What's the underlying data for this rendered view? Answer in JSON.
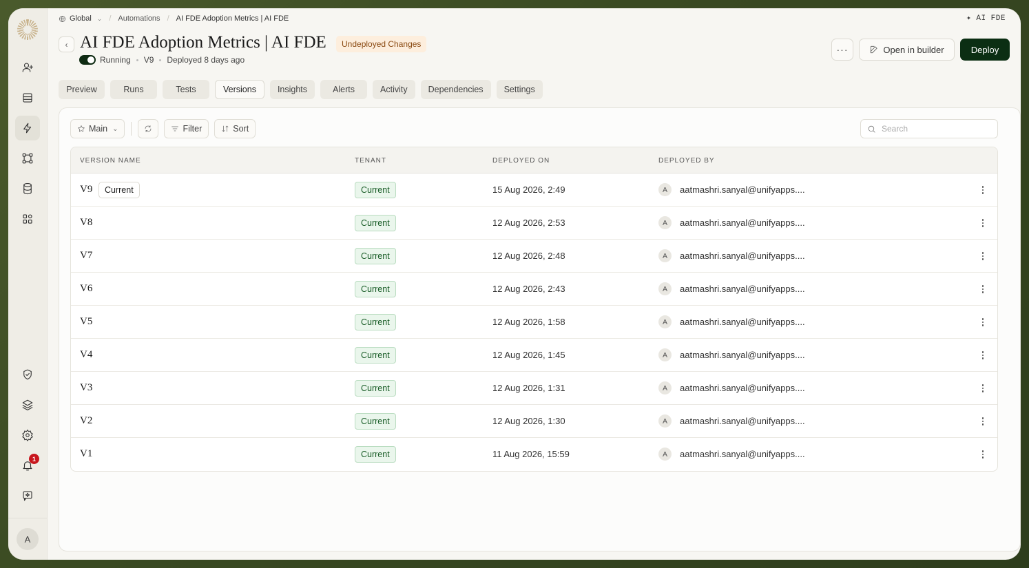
{
  "breadcrumb": {
    "scope": "Global",
    "section": "Automations",
    "current": "AI FDE Adoption Metrics | AI FDE"
  },
  "brand_mark": "✦ AI FDE",
  "header": {
    "title": "AI FDE Adoption Metrics | AI FDE",
    "badge": "Undeployed Changes",
    "status": "Running",
    "version": "V9",
    "deployed": "Deployed 8 days ago",
    "open_builder_label": "Open in builder",
    "deploy_label": "Deploy",
    "more_label": "···"
  },
  "tabs": [
    "Preview",
    "Runs",
    "Tests",
    "Versions",
    "Insights",
    "Alerts",
    "Activity",
    "Dependencies",
    "Settings"
  ],
  "active_tab": "Versions",
  "toolbar": {
    "branch": "Main",
    "filter": "Filter",
    "sort": "Sort",
    "search_placeholder": "Search"
  },
  "table": {
    "columns": [
      "VERSION NAME",
      "TENANT",
      "DEPLOYED ON",
      "DEPLOYED BY"
    ],
    "current_label": "Current",
    "rows": [
      {
        "version": "V9",
        "tenant": "Current",
        "deployed_on": "15 Aug 2026, 2:49",
        "avatar": "A",
        "deployed_by": "aatmashri.sanyal@unifyapps...."
      },
      {
        "version": "V8",
        "tenant": "Current",
        "deployed_on": "12 Aug 2026, 2:53",
        "avatar": "A",
        "deployed_by": "aatmashri.sanyal@unifyapps...."
      },
      {
        "version": "V7",
        "tenant": "Current",
        "deployed_on": "12 Aug 2026, 2:48",
        "avatar": "A",
        "deployed_by": "aatmashri.sanyal@unifyapps...."
      },
      {
        "version": "V6",
        "tenant": "Current",
        "deployed_on": "12 Aug 2026, 2:43",
        "avatar": "A",
        "deployed_by": "aatmashri.sanyal@unifyapps...."
      },
      {
        "version": "V5",
        "tenant": "Current",
        "deployed_on": "12 Aug 2026, 1:58",
        "avatar": "A",
        "deployed_by": "aatmashri.sanyal@unifyapps...."
      },
      {
        "version": "V4",
        "tenant": "Current",
        "deployed_on": "12 Aug 2026, 1:45",
        "avatar": "A",
        "deployed_by": "aatmashri.sanyal@unifyapps...."
      },
      {
        "version": "V3",
        "tenant": "Current",
        "deployed_on": "12 Aug 2026, 1:31",
        "avatar": "A",
        "deployed_by": "aatmashri.sanyal@unifyapps...."
      },
      {
        "version": "V2",
        "tenant": "Current",
        "deployed_on": "12 Aug 2026, 1:30",
        "avatar": "A",
        "deployed_by": "aatmashri.sanyal@unifyapps...."
      },
      {
        "version": "V1",
        "tenant": "Current",
        "deployed_on": "11 Aug 2026, 15:59",
        "avatar": "A",
        "deployed_by": "aatmashri.sanyal@unifyapps...."
      }
    ]
  },
  "sidebar": {
    "notification_count": "1",
    "user_initial": "A",
    "icons": [
      "users-icon",
      "inbox-icon",
      "lightning-icon",
      "workflow-icon",
      "database-icon",
      "apps-icon",
      "shield-icon",
      "layers-icon",
      "gear-icon",
      "bell-icon",
      "feedback-icon"
    ]
  }
}
